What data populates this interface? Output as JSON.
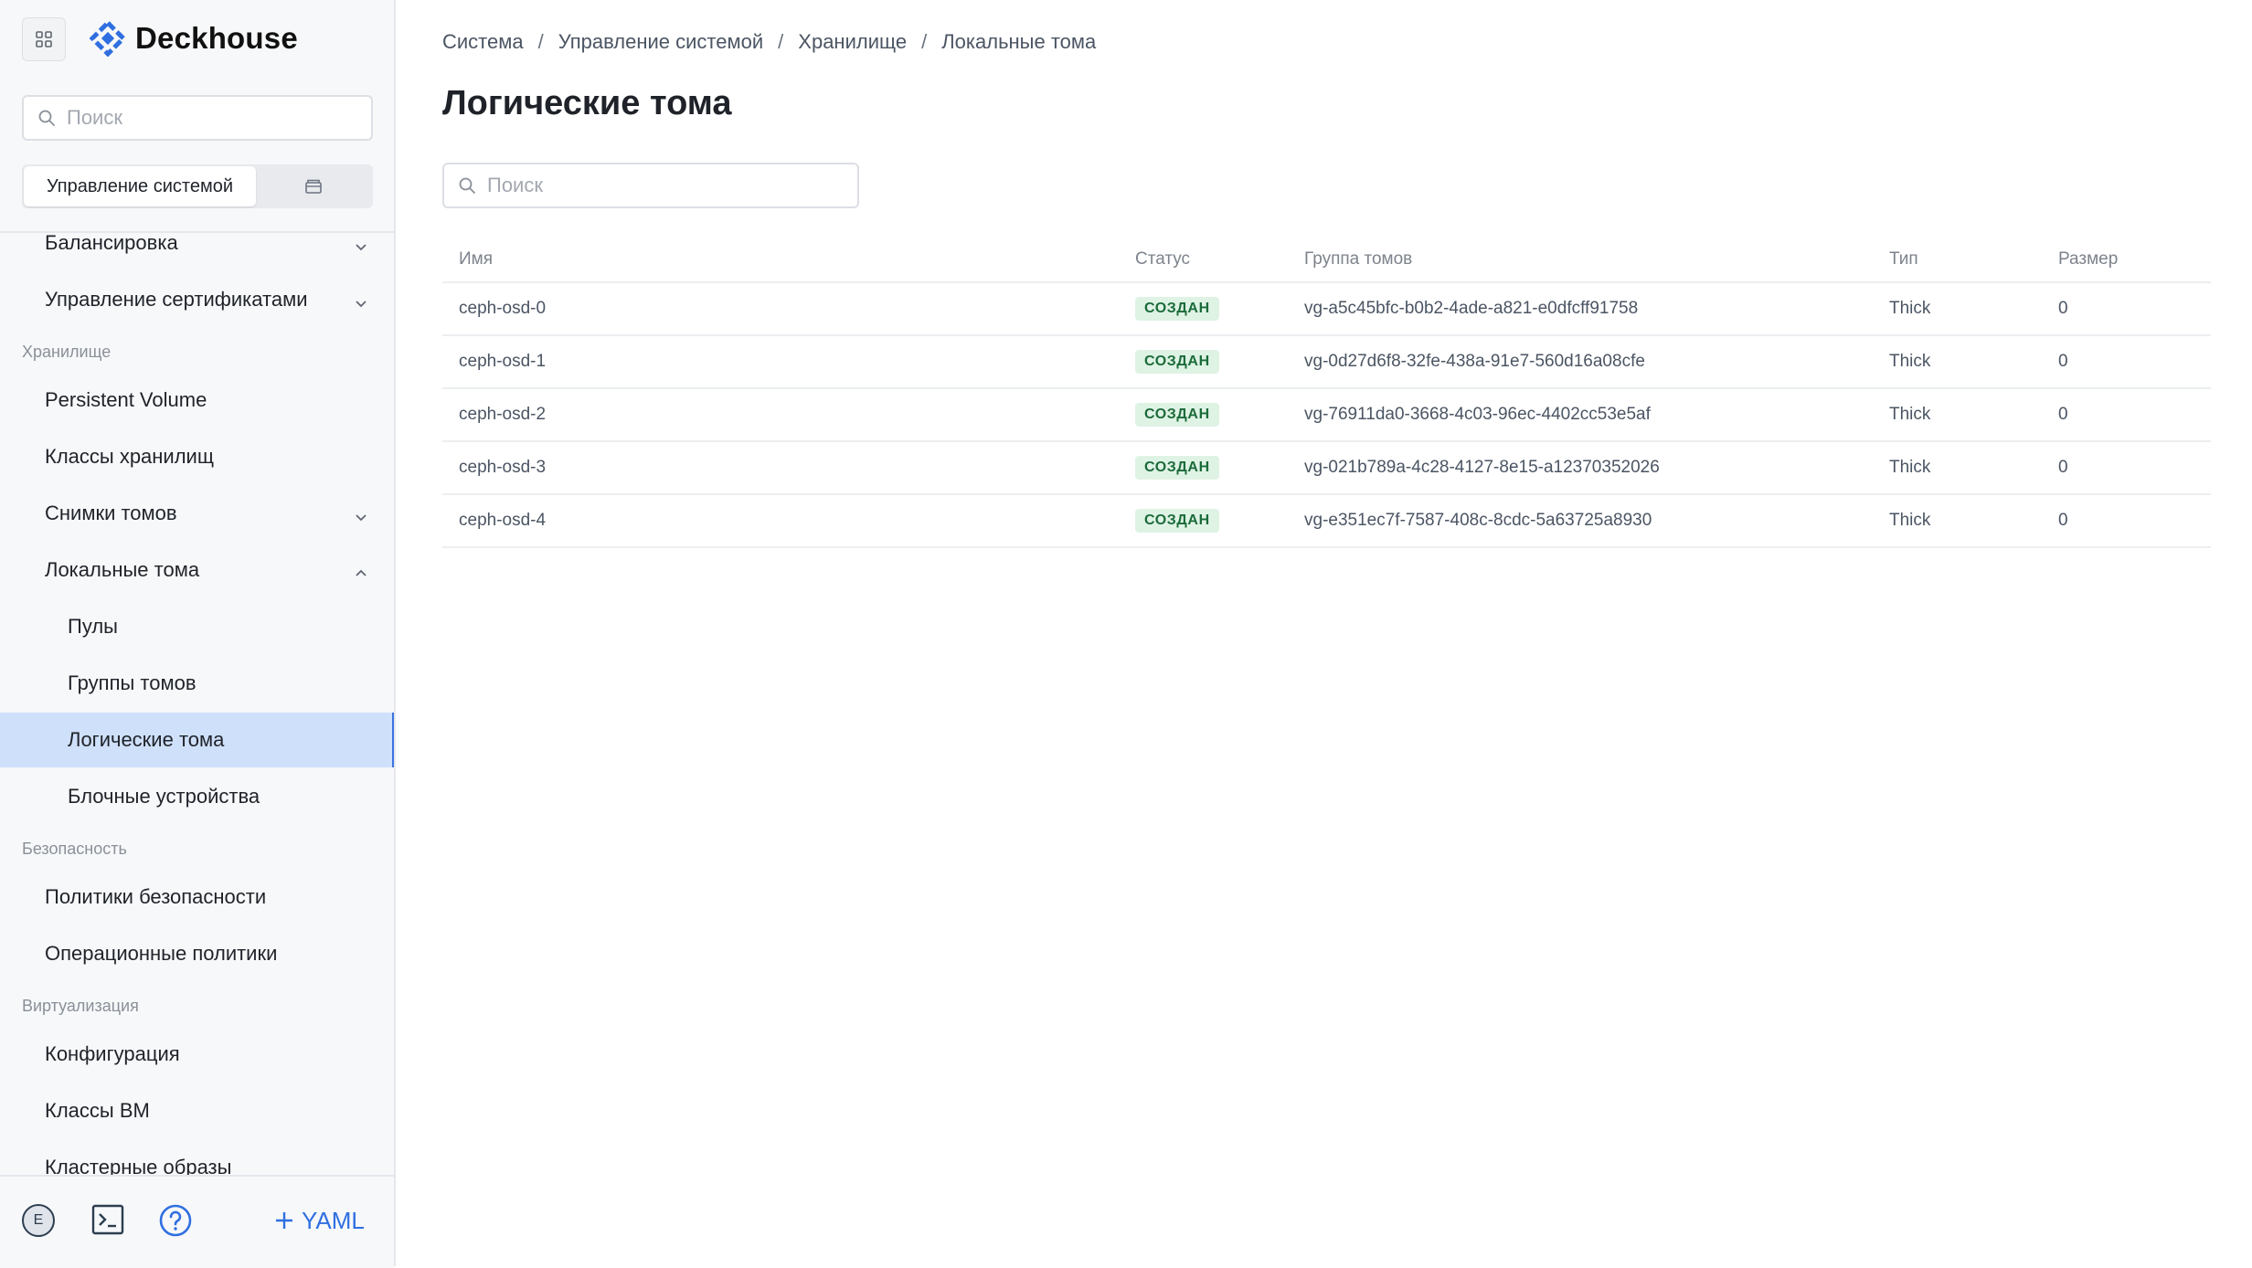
{
  "sidebar": {
    "logo": "Deckhouse",
    "search_placeholder": "Поиск",
    "segment": {
      "active_label": "Управление системой"
    },
    "items": [
      {
        "label": "Балансировка",
        "level": 1,
        "chevron": "down"
      },
      {
        "label": "Управление сертификатами",
        "level": 1,
        "chevron": "down"
      },
      {
        "section": "Хранилище"
      },
      {
        "label": "Persistent Volume",
        "level": 1
      },
      {
        "label": "Классы хранилищ",
        "level": 1
      },
      {
        "label": "Снимки томов",
        "level": 1,
        "chevron": "down"
      },
      {
        "label": "Локальные тома",
        "level": 1,
        "chevron": "up"
      },
      {
        "label": "Пулы",
        "level": 2
      },
      {
        "label": "Группы томов",
        "level": 2
      },
      {
        "label": "Логические тома",
        "level": 2,
        "active": true
      },
      {
        "label": "Блочные устройства",
        "level": 2
      },
      {
        "section": "Безопасность"
      },
      {
        "label": "Политики безопасности",
        "level": 1
      },
      {
        "label": "Операционные политики",
        "level": 1
      },
      {
        "section": "Виртуализация"
      },
      {
        "label": "Конфигурация",
        "level": 1
      },
      {
        "label": "Классы ВМ",
        "level": 1
      },
      {
        "label": "Кластерные образы",
        "level": 1
      }
    ],
    "bottom": {
      "avatar_letter": "E",
      "yaml_label": "YAML"
    }
  },
  "main": {
    "breadcrumb": [
      "Система",
      "Управление системой",
      "Хранилище",
      "Локальные тома"
    ],
    "title": "Логические тома",
    "search_placeholder": "Поиск",
    "table": {
      "headers": [
        "Имя",
        "Статус",
        "Группа томов",
        "Тип",
        "Размер"
      ],
      "rows": [
        {
          "name": "ceph-osd-0",
          "status": "СОЗДАН",
          "group": "vg-a5c45bfc-b0b2-4ade-a821-e0dfcff91758",
          "type": "Thick",
          "size": "0"
        },
        {
          "name": "ceph-osd-1",
          "status": "СОЗДАН",
          "group": "vg-0d27d6f8-32fe-438a-91e7-560d16a08cfe",
          "type": "Thick",
          "size": "0"
        },
        {
          "name": "ceph-osd-2",
          "status": "СОЗДАН",
          "group": "vg-76911da0-3668-4c03-96ec-4402cc53e5af",
          "type": "Thick",
          "size": "0"
        },
        {
          "name": "ceph-osd-3",
          "status": "СОЗДАН",
          "group": "vg-021b789a-4c28-4127-8e15-a12370352026",
          "type": "Thick",
          "size": "0"
        },
        {
          "name": "ceph-osd-4",
          "status": "СОЗДАН",
          "group": "vg-e351ec7f-7587-408c-8cdc-5a63725a8930",
          "type": "Thick",
          "size": "0"
        }
      ]
    }
  },
  "colors": {
    "accent": "#3b73e0",
    "active_bg": "#cfe0fb",
    "badge_bg": "#dff3e5",
    "badge_text": "#1b6b3a"
  }
}
